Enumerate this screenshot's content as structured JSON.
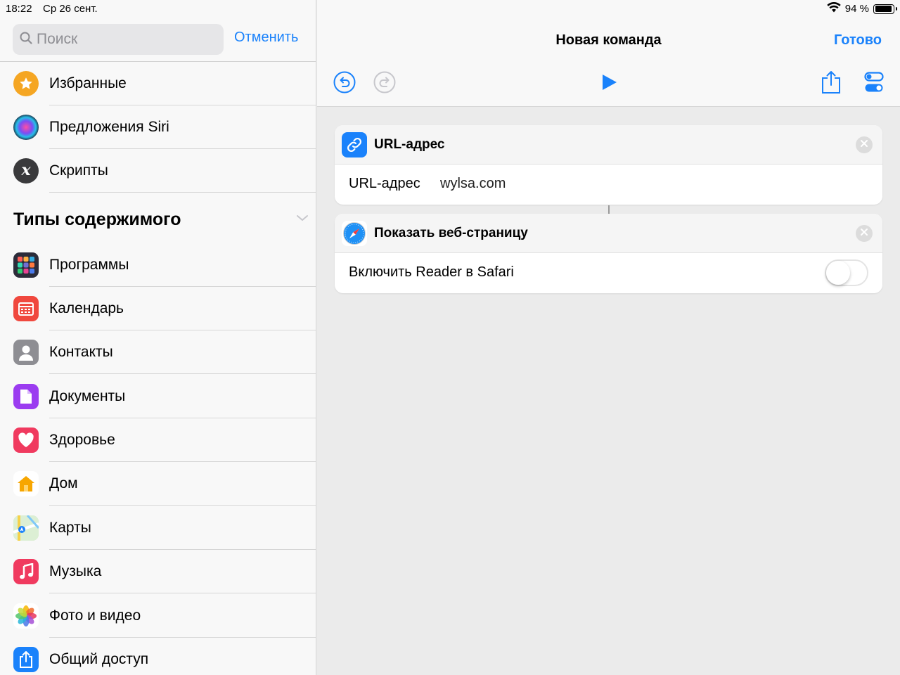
{
  "status_bar": {
    "time": "18:22",
    "date": "Ср 26 сент.",
    "battery": "94 %",
    "battery_level": 0.94
  },
  "sidebar": {
    "search": {
      "placeholder": "Поиск",
      "value": ""
    },
    "cancel_label": "Отменить",
    "top_items": [
      {
        "label": "Избранные",
        "icon": "star-icon",
        "color": "#f5a623"
      },
      {
        "label": "Предложения Siri",
        "icon": "siri-icon",
        "color": "#1b1b2f"
      },
      {
        "label": "Скрипты",
        "icon": "script-x-icon",
        "color": "#3a3a3c"
      }
    ],
    "section_title": "Типы содержимого",
    "content_items": [
      {
        "label": "Программы",
        "icon": "apps-grid-icon",
        "color": "#2c2c3a"
      },
      {
        "label": "Календарь",
        "icon": "calendar-icon",
        "color": "#f0483e"
      },
      {
        "label": "Контакты",
        "icon": "contact-icon",
        "color": "#8e8e93"
      },
      {
        "label": "Документы",
        "icon": "document-icon",
        "color": "#9b3cf0"
      },
      {
        "label": "Здоровье",
        "icon": "heart-icon",
        "color": "#f03a5f"
      },
      {
        "label": "Дом",
        "icon": "home-icon",
        "color": "#f7a600"
      },
      {
        "label": "Карты",
        "icon": "maps-icon",
        "color": "#6cc46a"
      },
      {
        "label": "Музыка",
        "icon": "music-icon",
        "color": "#f03a5f"
      },
      {
        "label": "Фото и видео",
        "icon": "photos-icon",
        "color": "#ffffff"
      },
      {
        "label": "Общий доступ",
        "icon": "share-icon",
        "color": "#1a82fb"
      }
    ]
  },
  "main": {
    "title": "Новая команда",
    "done_label": "Готово",
    "accent": "#1a82fb",
    "actions": [
      {
        "title": "URL-адрес",
        "icon": "link-icon",
        "param_label": "URL-адрес",
        "param_value": "wylsa.com"
      },
      {
        "title": "Показать веб-страницу",
        "icon": "safari-icon",
        "param_label": "Включить Reader в Safari",
        "toggle_on": false
      }
    ]
  }
}
